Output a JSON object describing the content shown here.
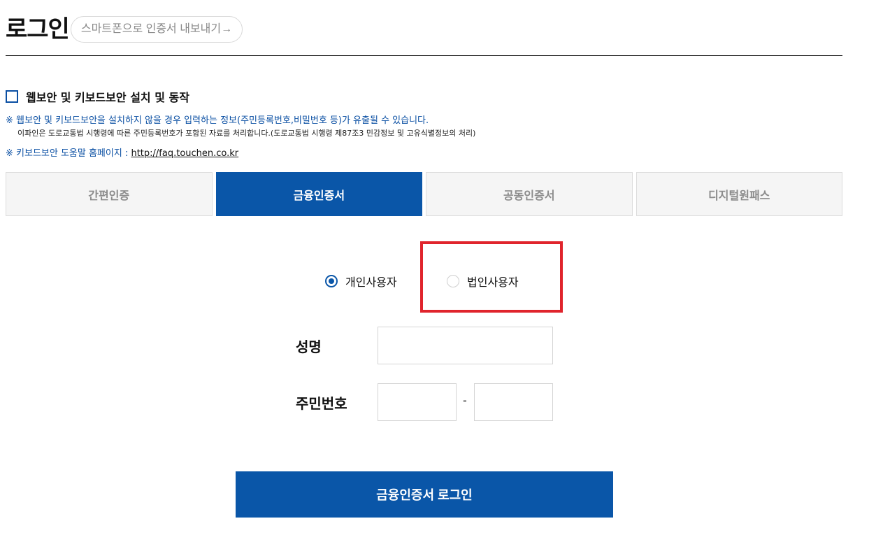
{
  "header": {
    "title": "로그인",
    "export_label": "스마트폰으로 인증서 내보내기→"
  },
  "security": {
    "checkbox_label": "웹보안 및 키보드보안 설치 및 동작",
    "checked": false,
    "notice_1": "※ 웹보안 및 키보드보안을 설치하지 않을 경우 입력하는 정보(주민등록번호,비밀번호 등)가 유출될 수 있습니다.",
    "notice_sub": "이파인은 도로교통법 시행령에 따른 주민등록번호가 포함된 자료를 처리합니다.(도로교통법 시행령 제87조3 민감정보 및 고유식별정보의 처리)",
    "notice_2_prefix": "※ 키보드보안 도움말 홈페이지 : ",
    "help_link": "http://faq.touchen.co.kr"
  },
  "tabs": [
    {
      "label": "간편인증",
      "active": false
    },
    {
      "label": "금융인증서",
      "active": true
    },
    {
      "label": "공동인증서",
      "active": false
    },
    {
      "label": "디지털원패스",
      "active": false
    }
  ],
  "user_type": {
    "options": [
      {
        "label": "개인사용자",
        "selected": true
      },
      {
        "label": "법인사용자",
        "selected": false
      }
    ]
  },
  "form": {
    "name_label": "성명",
    "name_value": "",
    "rrn_label": "주민번호",
    "rrn_first": "",
    "rrn_separator": "-",
    "rrn_second": ""
  },
  "submit_label": "금융인증서 로그인",
  "colors": {
    "primary": "#0a56a8",
    "highlight": "#e0242c",
    "tab_inactive_bg": "#f5f5f5"
  }
}
